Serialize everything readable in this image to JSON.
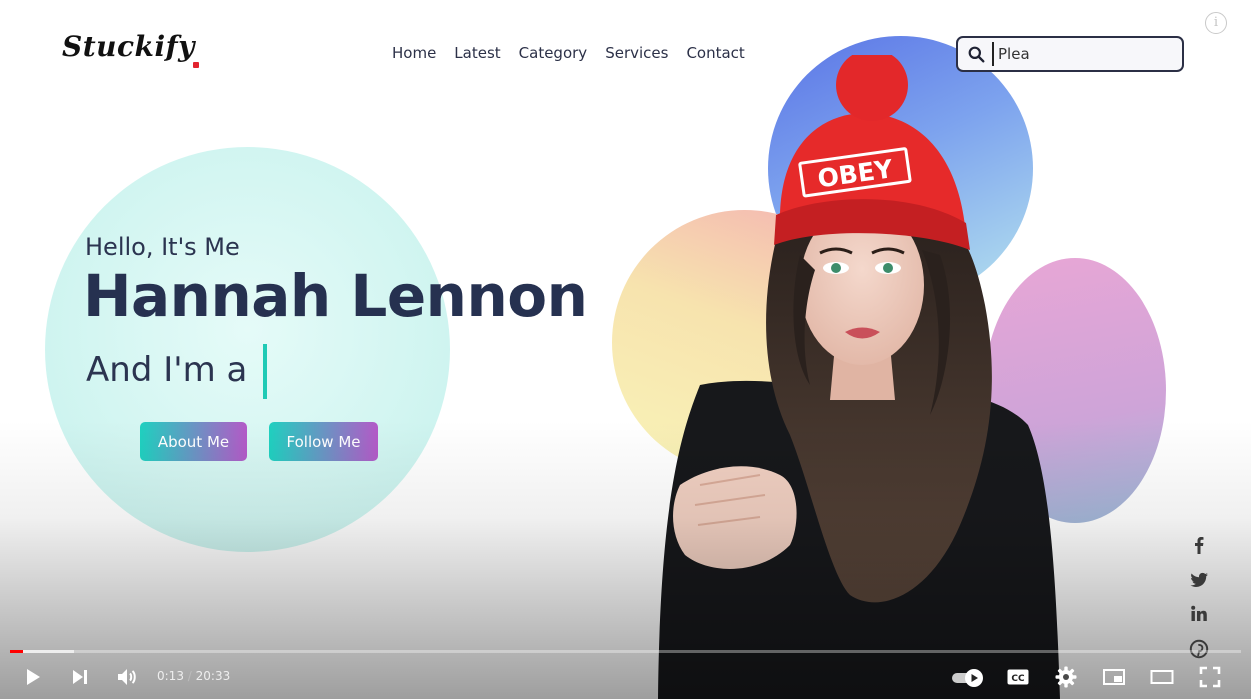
{
  "site": {
    "logo_text": "Stuckify",
    "nav": [
      "Home",
      "Latest",
      "Category",
      "Services",
      "Contact"
    ],
    "search_value": "Plea"
  },
  "hero": {
    "greeting": "Hello, It's Me",
    "name": "Hannah Lennon",
    "role_prefix": "And I'm a",
    "about_button": "About Me",
    "follow_button": "Follow Me",
    "hat_text": "OBEY"
  },
  "social_icons": [
    "facebook-icon",
    "twitter-icon",
    "linkedin-icon",
    "pinterest-icon"
  ],
  "player": {
    "current_time": "0:13",
    "separator": "/",
    "duration": "20:33",
    "progress_fraction": 0.0105,
    "buffered_fraction": 0.052,
    "progress_color": "#ff0000"
  },
  "colors": {
    "accent_teal": "#1fd1c0",
    "accent_purple": "#b45ac8",
    "text_dark": "#263150",
    "hat_red": "#e62a2a"
  }
}
